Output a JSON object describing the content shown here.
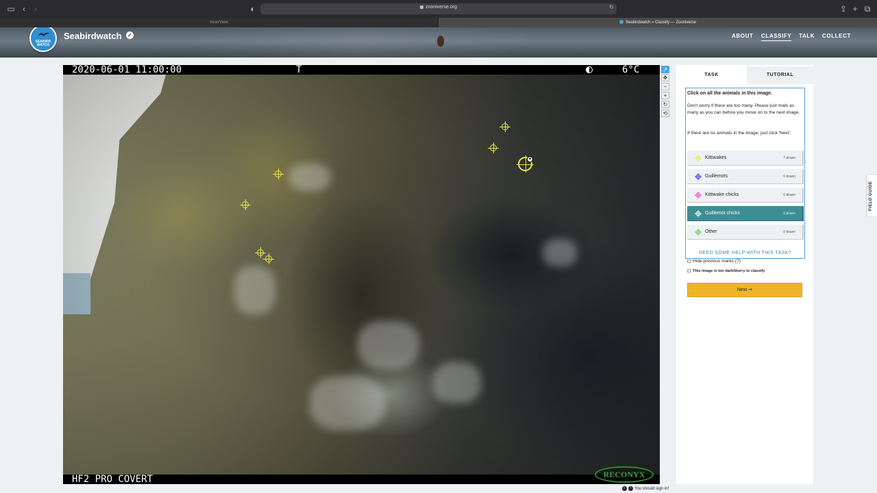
{
  "browser": {
    "url": "zooniverse.org",
    "tabs": [
      {
        "label": "InnerView"
      },
      {
        "label": "Seabirdwatch » Classify — Zooniverse"
      }
    ]
  },
  "header": {
    "logo_text": "SEABIRD WATCH",
    "project_title": "Seabirdwatch",
    "nav": [
      "ABOUT",
      "CLASSIFY",
      "TALK",
      "COLLECT"
    ],
    "active_nav": "CLASSIFY"
  },
  "subject": {
    "timestamp": "2020-06-01  11:00:00",
    "trigger": "T",
    "temperature": "6°C",
    "camera_model": "HF2 PRO COVERT",
    "brand": "RECONYX"
  },
  "toolbar": {
    "tools": [
      "pointer",
      "pan",
      "zoom-out",
      "zoom-in",
      "rotate",
      "reset"
    ]
  },
  "task_panel": {
    "tabs": [
      "TASK",
      "TUTORIAL"
    ],
    "active_tab": "TASK",
    "question": "Click on all the animals in this image.",
    "help_paragraphs": [
      "Don't worry if there are too many. Please just mark as many as you can before you move on to the next image.",
      "If there are no animals in the image, just click 'Next'."
    ],
    "choices": [
      {
        "label": "Kittiwakes",
        "count": "7 drawn",
        "color": "#e8e84a"
      },
      {
        "label": "Guillemots",
        "count": "0 drawn",
        "color": "#3b3bd6"
      },
      {
        "label": "Kittiwake chicks",
        "count": "0 drawn",
        "color": "#e24ad8"
      },
      {
        "label": "Guillemot chicks",
        "count": "0 drawn",
        "color": "#ffffff"
      },
      {
        "label": "Other",
        "count": "0 drawn",
        "color": "#5ed35e"
      }
    ],
    "active_choice": "Guillemot chicks",
    "help_link": "NEED SOME HELP WITH THIS TASK?",
    "hide_previous_marks": "Hide previous marks (7)",
    "too_dark": "This image is too dark/blurry to classify",
    "next_label": "Next ➞"
  },
  "field_guide_label": "FIELD GUIDE",
  "signin_note": "You should sign in!",
  "colors": {
    "accent_teal": "#3d8e93",
    "next_yellow": "#f0b429",
    "mark_yellow": "#e8e84a",
    "tool_active_blue": "#4aa7ea"
  }
}
